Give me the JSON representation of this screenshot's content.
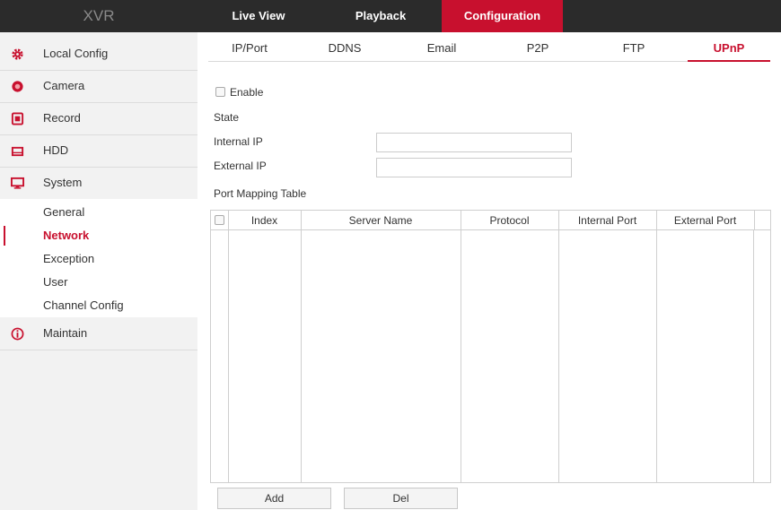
{
  "app": {
    "brand": "XVR"
  },
  "topnav": {
    "live_view": "Live View",
    "playback": "Playback",
    "configuration": "Configuration"
  },
  "sidebar": {
    "items": [
      {
        "label": "Local Config",
        "icon": "gear-icon"
      },
      {
        "label": "Camera",
        "icon": "camera-icon"
      },
      {
        "label": "Record",
        "icon": "record-icon"
      },
      {
        "label": "HDD",
        "icon": "hdd-icon"
      },
      {
        "label": "System",
        "icon": "monitor-icon"
      },
      {
        "label": "Maintain",
        "icon": "info-icon"
      }
    ],
    "system_sub": [
      "General",
      "Network",
      "Exception",
      "User",
      "Channel Config"
    ],
    "active_sub": "Network"
  },
  "tabs": [
    "IP/Port",
    "DDNS",
    "Email",
    "P2P",
    "FTP",
    "UPnP"
  ],
  "active_tab": "UPnP",
  "form": {
    "enable_label": "Enable",
    "enable_checked": false,
    "state_label": "State",
    "internal_ip_label": "Internal IP",
    "internal_ip_value": "",
    "external_ip_label": "External IP",
    "external_ip_value": ""
  },
  "table": {
    "title": "Port Mapping Table",
    "columns": [
      "Index",
      "Server Name",
      "Protocol",
      "Internal Port",
      "External Port"
    ],
    "rows": []
  },
  "buttons": {
    "add": "Add",
    "del": "Del"
  },
  "colors": {
    "accent": "#c8102e",
    "topbar": "#2b2b2b",
    "sidebar": "#f2f2f2"
  }
}
